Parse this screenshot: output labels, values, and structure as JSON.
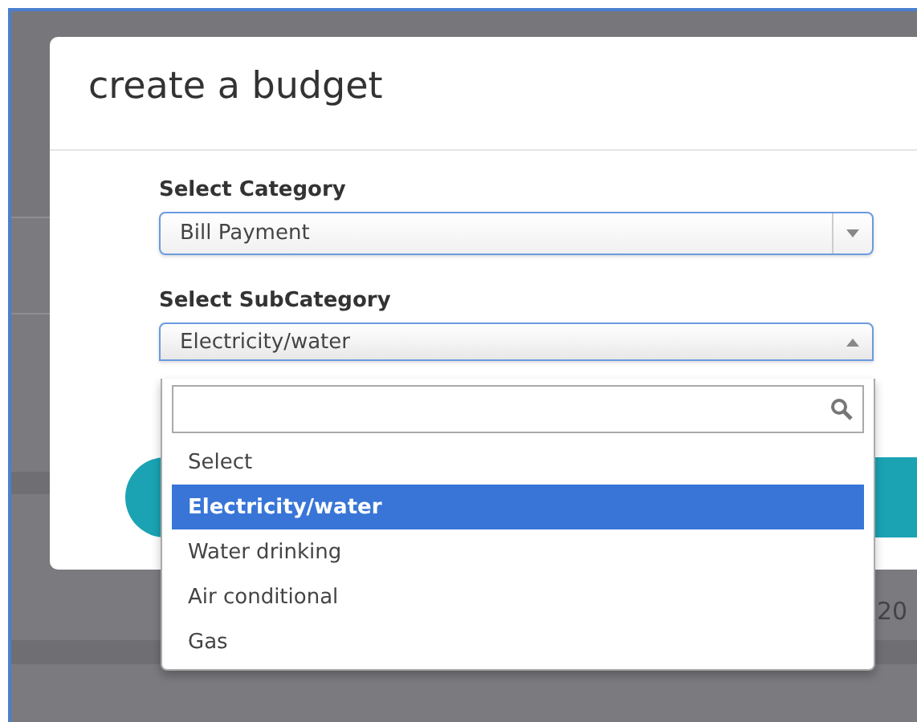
{
  "background": {
    "text": "20"
  },
  "modal": {
    "title": "create a budget",
    "fields": [
      {
        "label": "Select Category",
        "value": "Bill Payment",
        "open": false
      },
      {
        "label": "Select SubCategory",
        "value": "Electricity/water",
        "open": true
      }
    ]
  },
  "dropdown": {
    "options": [
      {
        "label": "Select",
        "selected": false
      },
      {
        "label": "Electricity/water",
        "selected": true
      },
      {
        "label": "Water drinking",
        "selected": false
      },
      {
        "label": "Air conditional",
        "selected": false
      },
      {
        "label": "Gas",
        "selected": false
      }
    ]
  }
}
